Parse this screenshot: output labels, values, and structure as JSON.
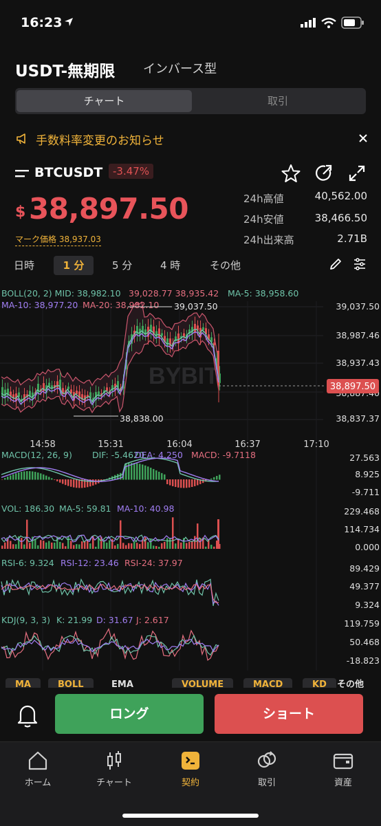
{
  "status": {
    "time": "16:23"
  },
  "header": {
    "title": "USDT-無期限",
    "subtitle": "インバース型"
  },
  "segment": {
    "chart": "チャート",
    "trade": "取引"
  },
  "notice": {
    "text": "手数料率変更のお知らせ"
  },
  "ticker": {
    "symbol": "BTCUSDT",
    "change": "-3.47%",
    "currency": "$",
    "price": "38,897.50",
    "mark_price": "マーク価格 38,937.03",
    "stats": [
      {
        "label": "24h高値",
        "value": "40,562.00"
      },
      {
        "label": "24h安値",
        "value": "38,466.50"
      },
      {
        "label": "24h出来高",
        "value": "2.71B"
      }
    ]
  },
  "timeframes": [
    "日時",
    "1 分",
    "5 分",
    "4 時",
    "その他"
  ],
  "selected_timeframe": "1 分",
  "chart": {
    "watermark": "BYBIT",
    "boll_header": {
      "boll": "BOLL(20, 2) MID: 38,982.10",
      "upper_lower": "39,028.77 38,935.42",
      "ma5": "MA-5: 38,958.60",
      "ma10": "MA-10: 38,977.20",
      "ma20": "MA-20: 38,982.10"
    },
    "price_axis": [
      "39,037.50",
      "38,987.46",
      "38,937.43",
      "38,887.40",
      "38,837.37"
    ],
    "current_price_tag": "38,897.50",
    "high_marker": "39,037.50",
    "low_marker": "38,838.00",
    "time_axis": [
      "14:58",
      "15:31",
      "16:04",
      "16:37",
      "17:10"
    ],
    "macd": {
      "header": {
        "label": "MACD(12, 26, 9)",
        "dif": "DIF: -5.4620",
        "dea": "DEA: 4.250",
        "macd": "MACD: -9.7118"
      },
      "axis": [
        "27.563",
        "8.925",
        "-9.711"
      ]
    },
    "vol": {
      "header": {
        "vol": "VOL: 186.30",
        "ma5": "MA-5: 59.81",
        "ma10": "MA-10: 40.98"
      },
      "axis": [
        "229.468",
        "114.734",
        "0.000"
      ]
    },
    "rsi": {
      "header": {
        "rsi6": "RSI-6: 9.324",
        "rsi12": "RSI-12: 23.46",
        "rsi24": "RSI-24: 37.97"
      },
      "axis": [
        "89.429",
        "49.377",
        "9.324"
      ]
    },
    "kdj": {
      "header": {
        "label": "KDJ(9, 3, 3)",
        "k": "K: 21.99",
        "d": "D: 31.67",
        "j": "J: 2.617"
      },
      "axis": [
        "119.759",
        "50.468",
        "-18.823"
      ]
    }
  },
  "indicator_tabs": [
    "MA",
    "BOLL",
    "EMA",
    "VOLUME",
    "MACD",
    "KD",
    "その他"
  ],
  "actions": {
    "long": "ロング",
    "short": "ショート"
  },
  "nav": [
    "ホーム",
    "チャート",
    "契約",
    "取引",
    "資産"
  ],
  "colors": {
    "up": "#3fa25a",
    "down": "#dc5050",
    "accent": "#f0b33a",
    "background": "#111111"
  }
}
